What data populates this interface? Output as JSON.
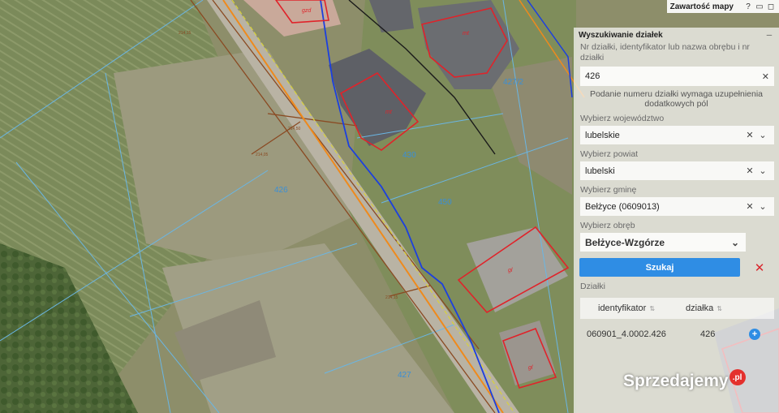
{
  "topbar": {
    "title": "Zawartość mapy",
    "icons": [
      "help-icon",
      "minimize-icon",
      "window-icon"
    ]
  },
  "map_labels": {
    "parcel_426": "426",
    "parcel_425": "425",
    "parcel_427": "427",
    "parcel_427_2": "427/2",
    "parcel_430": "430",
    "parcel_450": "450",
    "bld_a": "mt",
    "bld_b": "mt",
    "bld_c": "gl",
    "bld_d": "gl",
    "bld_e": "gzd"
  },
  "panel": {
    "title": "Wyszukiwanie działek",
    "field_label": "Nr działki, identyfikator lub nazwa obrębu i nr działki",
    "field_value": "426",
    "hint": "Podanie numeru działki wymaga uzupełnienia dodatkowych pól",
    "wojewodztwo_label": "Wybierz województwo",
    "wojewodztwo_value": "lubelskie",
    "powiat_label": "Wybierz powiat",
    "powiat_value": "lubelski",
    "gmina_label": "Wybierz gminę",
    "gmina_value": "Bełżyce (0609013)",
    "obreb_label": "Wybierz obręb",
    "obreb_value": "Bełżyce-Wzgórze",
    "search_label": "Szukaj",
    "results_label": "Działki",
    "columns": [
      "identyfikator",
      "działka"
    ],
    "rows": [
      {
        "id": "060901_4.0002.426",
        "parcel": "426"
      }
    ]
  },
  "watermark": {
    "text": "Sprzedajemy",
    "badge": ".pl"
  },
  "colors": {
    "accent": "#2f8de4",
    "danger": "#d9272e",
    "boundary_red": "#e0232a",
    "boundary_blue": "#1b3fe0",
    "road_orange": "#ef8a1c"
  }
}
